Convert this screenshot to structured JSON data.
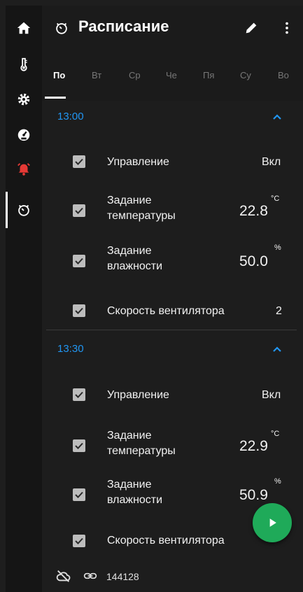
{
  "header": {
    "title": "Расписание"
  },
  "tabs": [
    "По",
    "Вт",
    "Ср",
    "Че",
    "Пя",
    "Су",
    "Во"
  ],
  "groups": [
    {
      "time": "13:00",
      "rows": [
        {
          "label": "Управление",
          "value": "Вкл"
        },
        {
          "label1": "Задание",
          "label2": "температуры",
          "value": "22.8",
          "unit": "°C"
        },
        {
          "label1": "Задание",
          "label2": "влажности",
          "value": "50.0",
          "unit": "%"
        },
        {
          "label": "Скорость вентилятора",
          "value": "2"
        }
      ]
    },
    {
      "time": "13:30",
      "rows": [
        {
          "label": "Управление",
          "value": "Вкл"
        },
        {
          "label1": "Задание",
          "label2": "температуры",
          "value": "22.9",
          "unit": "°C"
        },
        {
          "label1": "Задание",
          "label2": "влажности",
          "value": "50.9",
          "unit": "%"
        },
        {
          "label": "Скорость вентилятора"
        }
      ]
    }
  ],
  "footer": {
    "id": "144128"
  },
  "colors": {
    "accent": "#2196f3",
    "fab": "#1faa59",
    "alarm": "#e53935"
  },
  "icons": [
    "home-icon",
    "thermometer-icon",
    "gear-icon",
    "gauge-icon",
    "alarm-bell-icon",
    "schedule-icon",
    "edit-icon",
    "more-vert-icon",
    "chevron-up-icon",
    "checkbox-icon",
    "play-icon",
    "cloud-off-icon",
    "link-icon"
  ]
}
